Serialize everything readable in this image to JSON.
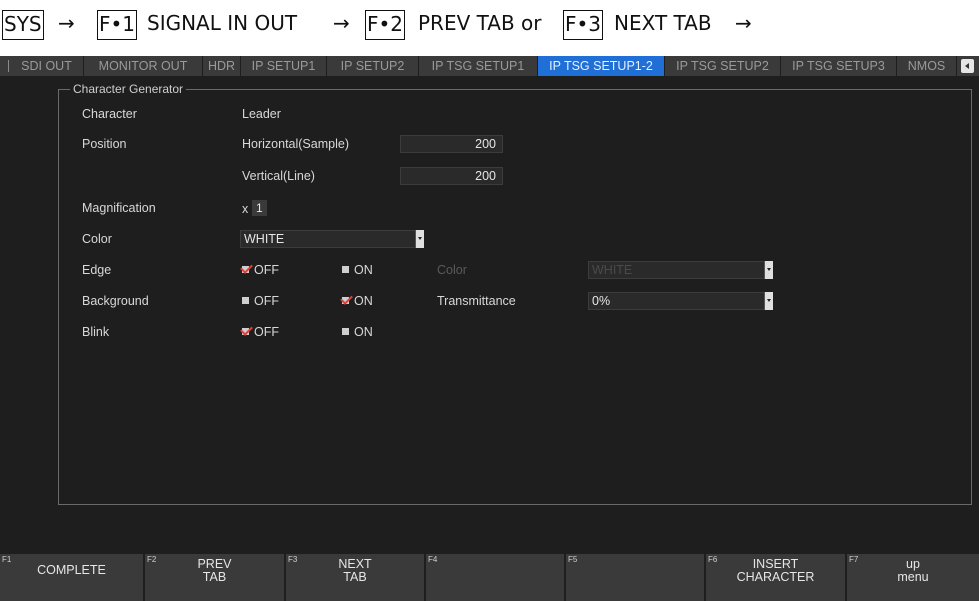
{
  "instruction": {
    "sys_key": "SYS",
    "arrow": "→",
    "f1_key": "F•1",
    "f1_text": "SIGNAL IN OUT",
    "f2_key": "F•2",
    "f2_text": "PREV TAB or",
    "f3_key": "F•3",
    "f3_text": "NEXT TAB"
  },
  "tabs": [
    {
      "label": "SDI OUT"
    },
    {
      "label": "MONITOR OUT"
    },
    {
      "label": "HDR"
    },
    {
      "label": "IP SETUP1"
    },
    {
      "label": "IP SETUP2"
    },
    {
      "label": "IP TSG SETUP1"
    },
    {
      "label": "IP TSG SETUP1-2",
      "active": true
    },
    {
      "label": "IP TSG SETUP2"
    },
    {
      "label": "IP TSG SETUP3"
    },
    {
      "label": "NMOS"
    }
  ],
  "panel": {
    "legend": "Character Generator",
    "character": {
      "label": "Character",
      "value": "Leader"
    },
    "position": {
      "label": "Position",
      "h_label": "Horizontal(Sample)",
      "h_value": "200",
      "v_label": "Vertical(Line)",
      "v_value": "200"
    },
    "magnification": {
      "label": "Magnification",
      "prefix": "x",
      "value": "1"
    },
    "color": {
      "label": "Color",
      "value": "WHITE"
    },
    "edge": {
      "label": "Edge",
      "off": "OFF",
      "on": "ON",
      "selected": "OFF",
      "color_label": "Color",
      "color_value": "WHITE"
    },
    "background": {
      "label": "Background",
      "off": "OFF",
      "on": "ON",
      "selected": "ON",
      "transmittance_label": "Transmittance",
      "transmittance_value": "0%"
    },
    "blink": {
      "label": "Blink",
      "off": "OFF",
      "on": "ON",
      "selected": "OFF"
    }
  },
  "fkeys": [
    {
      "num": "F1",
      "line1": "COMPLETE",
      "line2": ""
    },
    {
      "num": "F2",
      "line1": "PREV",
      "line2": "TAB"
    },
    {
      "num": "F3",
      "line1": "NEXT",
      "line2": "TAB"
    },
    {
      "num": "F4",
      "line1": "",
      "line2": ""
    },
    {
      "num": "F5",
      "line1": "",
      "line2": ""
    },
    {
      "num": "F6",
      "line1": "INSERT",
      "line2": "CHARACTER"
    },
    {
      "num": "F7",
      "line1": "up",
      "line2": "menu"
    }
  ],
  "colors": {
    "active_tab": "#1f6fd6",
    "check_mark": "#e0403a",
    "background": "#1e1e1e"
  }
}
